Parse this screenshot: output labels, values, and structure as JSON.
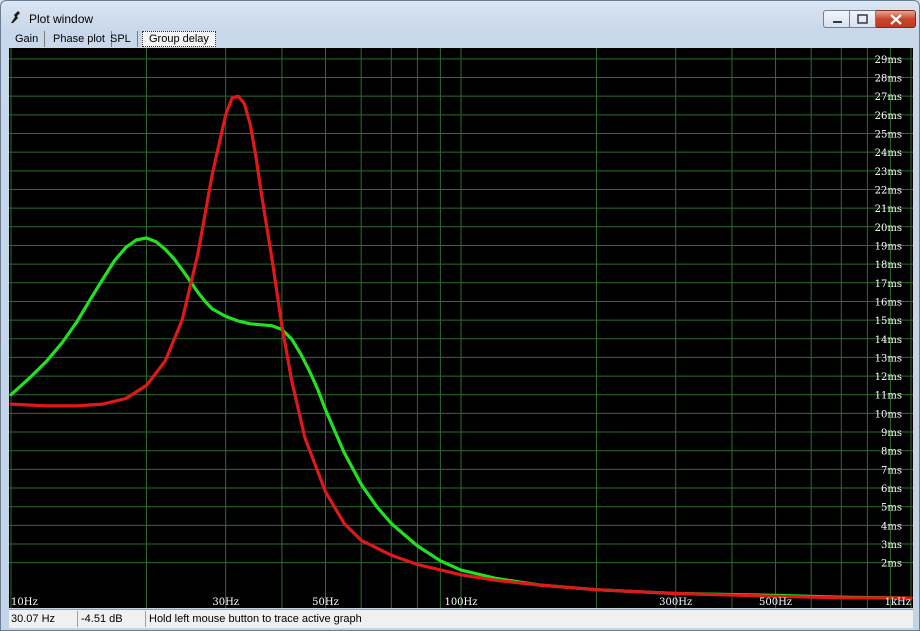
{
  "window": {
    "title": "Plot window"
  },
  "tabs": [
    {
      "label": "Gain"
    },
    {
      "label": "Phase plot"
    },
    {
      "label": "SPL"
    },
    {
      "label": "Group delay"
    }
  ],
  "active_tab": 3,
  "status": {
    "frequency": "30.07 Hz",
    "level": "-4.51 dB",
    "hint": "Hold left mouse button to trace active graph"
  },
  "colors": {
    "background": "#000000",
    "grid": "#2e6b2e",
    "labels": "#ffffff",
    "series_green": "#22e022",
    "series_red": "#e01818"
  },
  "chart_data": {
    "type": "line",
    "x_scale": "log",
    "xlim": [
      10,
      1000
    ],
    "ylim": [
      0,
      30
    ],
    "grid": true,
    "x_ticks": [
      {
        "value": 10,
        "label": "10Hz"
      },
      {
        "value": 30,
        "label": "30Hz"
      },
      {
        "value": 50,
        "label": "50Hz"
      },
      {
        "value": 100,
        "label": "100Hz"
      },
      {
        "value": 300,
        "label": "300Hz"
      },
      {
        "value": 500,
        "label": "500Hz"
      },
      {
        "value": 1000,
        "label": "1kHz"
      }
    ],
    "x_grid": [
      10,
      20,
      30,
      40,
      50,
      60,
      70,
      80,
      90,
      100,
      200,
      300,
      400,
      500,
      600,
      700,
      800,
      900,
      1000
    ],
    "y_ticks": [
      {
        "value": 2,
        "label": "2ms"
      },
      {
        "value": 3,
        "label": "3ms"
      },
      {
        "value": 4,
        "label": "4ms"
      },
      {
        "value": 5,
        "label": "5ms"
      },
      {
        "value": 6,
        "label": "6ms"
      },
      {
        "value": 7,
        "label": "7ms"
      },
      {
        "value": 8,
        "label": "8ms"
      },
      {
        "value": 9,
        "label": "9ms"
      },
      {
        "value": 10,
        "label": "10ms"
      },
      {
        "value": 11,
        "label": "11ms"
      },
      {
        "value": 12,
        "label": "12ms"
      },
      {
        "value": 13,
        "label": "13ms"
      },
      {
        "value": 14,
        "label": "14ms"
      },
      {
        "value": 15,
        "label": "15ms"
      },
      {
        "value": 16,
        "label": "16ms"
      },
      {
        "value": 17,
        "label": "17ms"
      },
      {
        "value": 18,
        "label": "18ms"
      },
      {
        "value": 19,
        "label": "19ms"
      },
      {
        "value": 20,
        "label": "20ms"
      },
      {
        "value": 21,
        "label": "21ms"
      },
      {
        "value": 22,
        "label": "22ms"
      },
      {
        "value": 23,
        "label": "23ms"
      },
      {
        "value": 24,
        "label": "24ms"
      },
      {
        "value": 25,
        "label": "25ms"
      },
      {
        "value": 26,
        "label": "26ms"
      },
      {
        "value": 27,
        "label": "27ms"
      },
      {
        "value": 28,
        "label": "28ms"
      },
      {
        "value": 29,
        "label": "29ms"
      }
    ],
    "series": [
      {
        "color": "#22e022",
        "points": [
          [
            10,
            11.0
          ],
          [
            11,
            11.9
          ],
          [
            12,
            12.8
          ],
          [
            13,
            13.8
          ],
          [
            14,
            14.9
          ],
          [
            15,
            16.1
          ],
          [
            16,
            17.2
          ],
          [
            17,
            18.2
          ],
          [
            18,
            18.9
          ],
          [
            19,
            19.3
          ],
          [
            20,
            19.4
          ],
          [
            21,
            19.2
          ],
          [
            22,
            18.8
          ],
          [
            23,
            18.3
          ],
          [
            24,
            17.7
          ],
          [
            25,
            17.1
          ],
          [
            26,
            16.5
          ],
          [
            27,
            16.0
          ],
          [
            28,
            15.6
          ],
          [
            30,
            15.2
          ],
          [
            32,
            14.95
          ],
          [
            34,
            14.8
          ],
          [
            36,
            14.75
          ],
          [
            38,
            14.7
          ],
          [
            40,
            14.5
          ],
          [
            42,
            14.0
          ],
          [
            44,
            13.2
          ],
          [
            46,
            12.3
          ],
          [
            48,
            11.3
          ],
          [
            50,
            10.2
          ],
          [
            55,
            7.9
          ],
          [
            60,
            6.2
          ],
          [
            65,
            5.0
          ],
          [
            70,
            4.1
          ],
          [
            80,
            2.9
          ],
          [
            90,
            2.1
          ],
          [
            100,
            1.6
          ],
          [
            120,
            1.15
          ],
          [
            150,
            0.8
          ],
          [
            200,
            0.55
          ],
          [
            300,
            0.35
          ],
          [
            500,
            0.25
          ],
          [
            700,
            0.15
          ],
          [
            1000,
            0.1
          ]
        ]
      },
      {
        "color": "#e01818",
        "points": [
          [
            10,
            10.5
          ],
          [
            12,
            10.4
          ],
          [
            14,
            10.4
          ],
          [
            16,
            10.5
          ],
          [
            18,
            10.8
          ],
          [
            20,
            11.5
          ],
          [
            22,
            12.8
          ],
          [
            24,
            15.0
          ],
          [
            26,
            18.5
          ],
          [
            28,
            22.8
          ],
          [
            30,
            26.0
          ],
          [
            31,
            26.9
          ],
          [
            32,
            27.0
          ],
          [
            33,
            26.6
          ],
          [
            34,
            25.5
          ],
          [
            35,
            23.8
          ],
          [
            36,
            21.8
          ],
          [
            38,
            18.3
          ],
          [
            40,
            14.7
          ],
          [
            42,
            11.8
          ],
          [
            45,
            8.7
          ],
          [
            50,
            5.8
          ],
          [
            55,
            4.1
          ],
          [
            60,
            3.2
          ],
          [
            70,
            2.4
          ],
          [
            80,
            1.9
          ],
          [
            100,
            1.35
          ],
          [
            120,
            1.05
          ],
          [
            150,
            0.8
          ],
          [
            200,
            0.55
          ],
          [
            300,
            0.35
          ],
          [
            500,
            0.2
          ],
          [
            700,
            0.12
          ],
          [
            1000,
            0.1
          ]
        ]
      }
    ]
  }
}
